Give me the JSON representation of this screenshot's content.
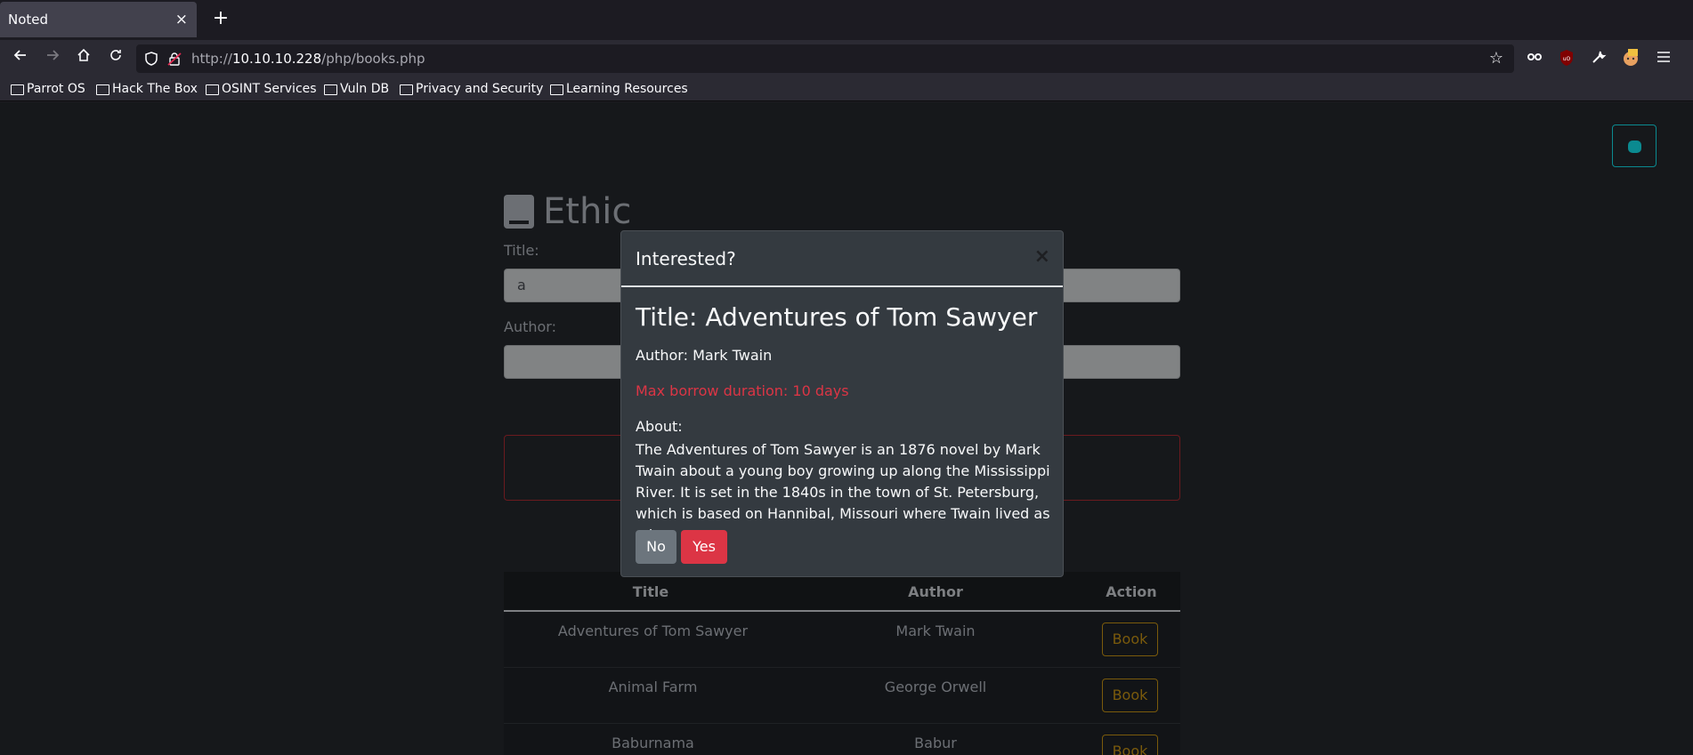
{
  "browser": {
    "tab_title": "Noted",
    "tab_close": "×",
    "new_tab": "+",
    "url_host": "10.10.10.228",
    "url_prefix": "http://",
    "url_path": "/php/books.php",
    "bookmarks": [
      "Parrot OS",
      "Hack The Box",
      "OSINT Services",
      "Vuln DB",
      "Privacy and Security",
      "Learning Resources"
    ]
  },
  "page": {
    "heading": "Ethic",
    "title_label": "Title:",
    "title_value": "a",
    "author_label": "Author:",
    "author_value": "",
    "table": {
      "headers": [
        "Title",
        "Author",
        "Action"
      ],
      "rows": [
        {
          "title": "Adventures of Tom Sawyer",
          "author": "Mark Twain",
          "action": "Book"
        },
        {
          "title": "Animal Farm",
          "author": "George Orwell",
          "action": "Book"
        },
        {
          "title": "Baburnama",
          "author": "Babur",
          "action": "Book"
        }
      ]
    }
  },
  "modal": {
    "header": "Interested?",
    "close": "×",
    "title": "Title: Adventures of Tom Sawyer",
    "author": "Author: Mark Twain",
    "max_borrow": "Max borrow duration: 10 days",
    "about_heading": "About:",
    "about_text": "The Adventures of Tom Sawyer is an 1876 novel by Mark Twain about a young boy growing up along the Mississippi River. It is set in the 1840s in the town of St. Petersburg, which is based on Hannibal, Missouri where Twain lived as a boy.",
    "no_label": "No",
    "yes_label": "Yes"
  },
  "colors": {
    "danger": "#dc3545",
    "secondary": "#6c757d",
    "modal_bg": "#343a40",
    "info": "#0b8a90",
    "warning_outline": "#7a5a0c"
  }
}
